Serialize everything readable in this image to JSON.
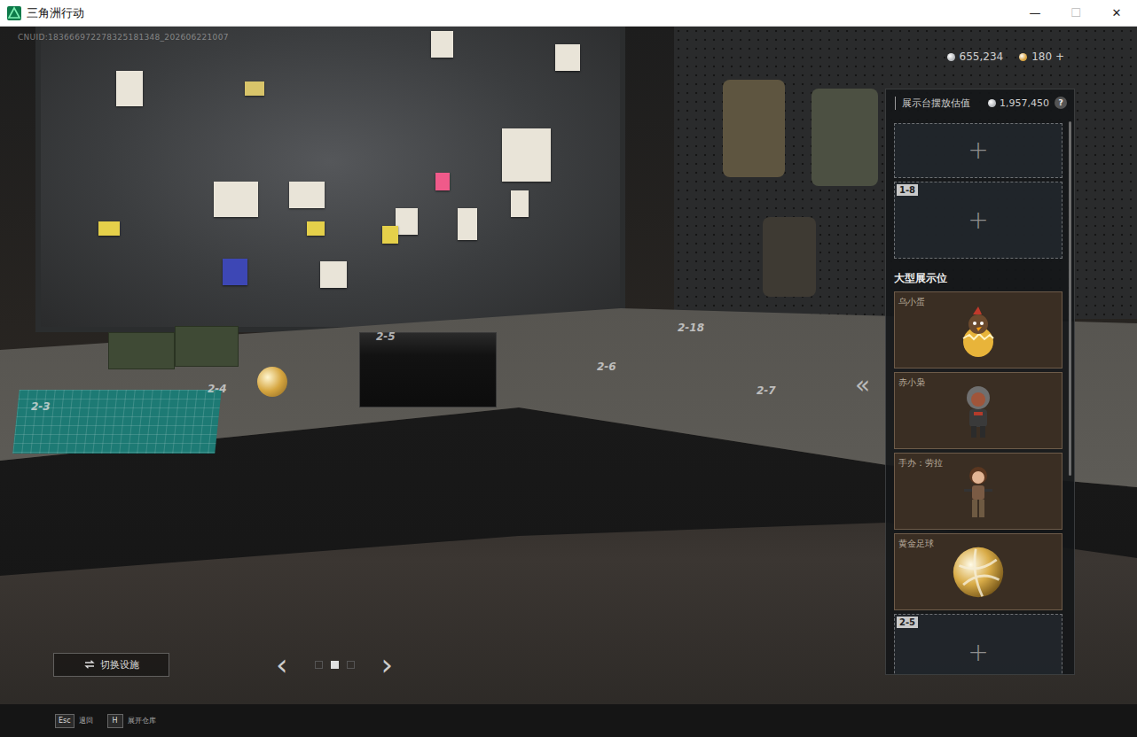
{
  "window": {
    "title": "三角洲行动",
    "controls": [
      "—",
      "☐",
      "✕"
    ]
  },
  "uid": "CNUID:183666972278325181348_202606221007",
  "currencies": [
    {
      "amount": "655,234",
      "color": "#b9bcc0"
    },
    {
      "amount": "180 +",
      "color": "#d9a441"
    }
  ],
  "panel": {
    "title": "展示台摆放估值",
    "value": "1,957,450",
    "help": "?",
    "top_slots": [
      {
        "label": "",
        "kind": "empty"
      },
      {
        "label": "1-8",
        "kind": "empty"
      }
    ],
    "section": "大型展示位",
    "large_slots": [
      {
        "label": "乌小蛋",
        "kind": "chick"
      },
      {
        "label": "赤小枭",
        "kind": "hood"
      },
      {
        "label": "手办：劳拉",
        "kind": "laura"
      },
      {
        "label": "黄金足球",
        "kind": "ball"
      },
      {
        "label": "2-5",
        "kind": "empty"
      }
    ],
    "add": "+"
  },
  "collapse": "«",
  "scene_labels": [
    "2-3",
    "2-4",
    "2-5",
    "2-6",
    "2-7",
    "2-18"
  ],
  "switch_button": "切换设施",
  "pager": {
    "prev": "‹",
    "next": "›",
    "pages": [
      {
        "selected": false
      },
      {
        "selected": true
      },
      {
        "selected": false
      }
    ]
  },
  "hints": [
    {
      "key": "Esc",
      "label": "退回"
    },
    {
      "key": "H",
      "label": "展开仓库"
    }
  ]
}
